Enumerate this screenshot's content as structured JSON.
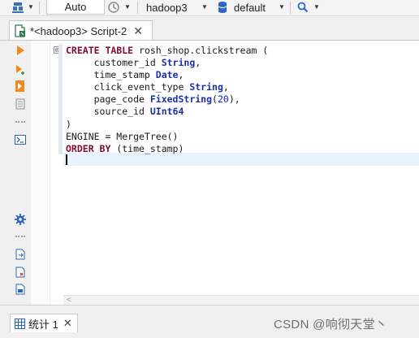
{
  "toolbar": {
    "transaction_mode": "Auto",
    "connection": "hadoop3",
    "database": "default",
    "icons": [
      "database-icon",
      "history-icon",
      "database-cylinder-icon",
      "search-icon"
    ]
  },
  "editor_tab": {
    "title": "*<hadoop3> Script-2",
    "close_label": "✕"
  },
  "code_lines": [
    [
      {
        "t": "CREATE TABLE ",
        "c": "kw"
      },
      {
        "t": "rosh_shop.clickstream (",
        "c": ""
      }
    ],
    [
      {
        "t": "     customer_id ",
        "c": ""
      },
      {
        "t": "String",
        "c": "ty"
      },
      {
        "t": ",",
        "c": ""
      }
    ],
    [
      {
        "t": "     time_stamp ",
        "c": ""
      },
      {
        "t": "Date",
        "c": "ty"
      },
      {
        "t": ",",
        "c": ""
      }
    ],
    [
      {
        "t": "     click_event_type ",
        "c": ""
      },
      {
        "t": "String",
        "c": "ty"
      },
      {
        "t": ",",
        "c": ""
      }
    ],
    [
      {
        "t": "     page_code ",
        "c": ""
      },
      {
        "t": "FixedString",
        "c": "ty"
      },
      {
        "t": "(",
        "c": ""
      },
      {
        "t": "20",
        "c": "num"
      },
      {
        "t": "),",
        "c": ""
      }
    ],
    [
      {
        "t": "     source_id ",
        "c": ""
      },
      {
        "t": "UInt64",
        "c": "ty"
      }
    ],
    [
      {
        "t": ")",
        "c": ""
      }
    ],
    [
      {
        "t": "ENGINE = MergeTree()",
        "c": ""
      }
    ],
    [
      {
        "t": "ORDER BY ",
        "c": "kw"
      },
      {
        "t": "(time_stamp)",
        "c": ""
      }
    ]
  ],
  "fold_marker": "⊖",
  "results": {
    "tab_label": "统计 1",
    "close_label": "✕"
  },
  "watermark": "CSDN @响彻天堂丶",
  "colors": {
    "keyword": "#7f0c2c",
    "type": "#1d2fa8",
    "number": "#0a24c7",
    "current_line": "#e8f2fe"
  }
}
